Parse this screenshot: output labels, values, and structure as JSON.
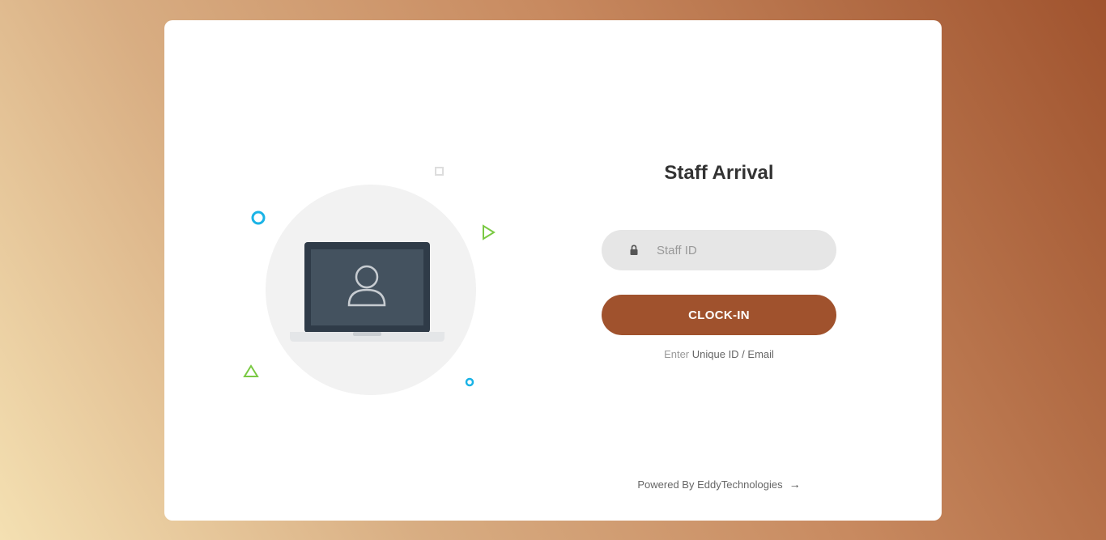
{
  "form": {
    "title": "Staff Arrival",
    "staff_id_placeholder": "Staff ID",
    "staff_id_value": "",
    "submit_label": "CLOCK-IN",
    "hint_prefix": "Enter",
    "hint_link": "Unique ID / Email"
  },
  "footer": {
    "powered_by": "Powered By EddyTechnologies",
    "arrow_icon": "→"
  },
  "icons": {
    "lock": "lock-icon",
    "illustration": "laptop-user-icon"
  },
  "colors": {
    "accent": "#a0522d",
    "input_bg": "#e6e6e6",
    "decor_blue": "#1ab3e6",
    "decor_green": "#7ac943"
  }
}
